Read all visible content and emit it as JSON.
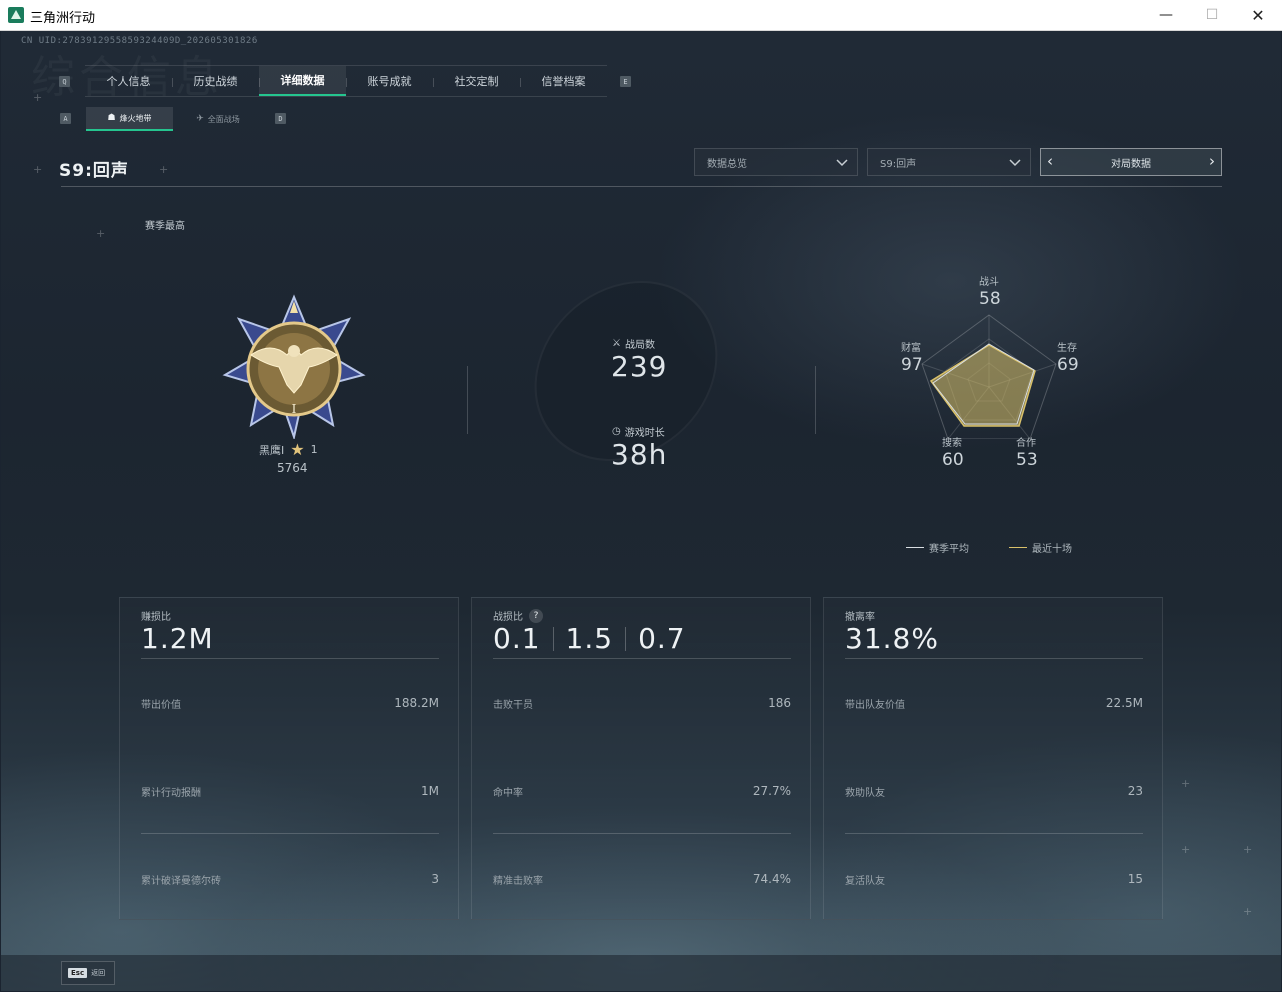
{
  "window": {
    "title": "三角洲行动",
    "minimize": "—",
    "maximize": "☐",
    "close": "✕"
  },
  "uid": "CN UID:2783912955859324409D_202605301826",
  "watermark": "综合信息",
  "keycaps": {
    "prev_tab": "Q",
    "next_tab": "E",
    "prev_sub": "A",
    "next_sub": "D"
  },
  "tabs": [
    {
      "label": "个人信息"
    },
    {
      "label": "历史战绩"
    },
    {
      "label": "详细数据",
      "active": true
    },
    {
      "label": "账号成就"
    },
    {
      "label": "社交定制"
    },
    {
      "label": "信誉档案"
    }
  ],
  "subtabs": [
    {
      "label": "烽火地带",
      "icon": "☗",
      "active": true
    },
    {
      "label": "全面战场",
      "icon": "✈",
      "active": false
    }
  ],
  "season": {
    "title": "S9:回声"
  },
  "dropdowns": {
    "overview": "数据总览",
    "season": "S9:回声"
  },
  "pager": {
    "label": "对局数据",
    "prev": "‹",
    "next": "›"
  },
  "season_best": "赛季最高",
  "rank": {
    "name": "黑鹰I",
    "stars": "1",
    "points": "5764",
    "star_icon": "★"
  },
  "matches": {
    "label": "战局数",
    "value": "239",
    "icon": "⚔"
  },
  "playtime": {
    "label": "游戏时长",
    "value": "38h",
    "icon": "◷"
  },
  "radar": {
    "combat": {
      "label": "战斗",
      "value": "58"
    },
    "survival": {
      "label": "生存",
      "value": "69"
    },
    "cooperation": {
      "label": "合作",
      "value": "53"
    },
    "search": {
      "label": "搜索",
      "value": "60"
    },
    "wealth": {
      "label": "财富",
      "value": "97"
    }
  },
  "legend": {
    "season_avg": {
      "label": "赛季平均",
      "color": "#d9dee2"
    },
    "recent_ten": {
      "label": "最近十场",
      "color": "#d9c16a"
    }
  },
  "panels": {
    "profit": {
      "label": "赚损比",
      "value": "1.2M",
      "rows": [
        {
          "k": "带出价值",
          "v": "188.2M"
        },
        {
          "k": "累计行动报酬",
          "v": "1M"
        },
        {
          "k": "累计破译曼德尔砖",
          "v": "3"
        }
      ]
    },
    "kd": {
      "label": "战损比",
      "help": "?",
      "values": [
        "0.1",
        "1.5",
        "0.7"
      ],
      "rows": [
        {
          "k": "击败干员",
          "v": "186"
        },
        {
          "k": "命中率",
          "v": "27.7%"
        },
        {
          "k": "精准击败率",
          "v": "74.4%"
        }
      ]
    },
    "extract": {
      "label": "撤离率",
      "value": "31.8%",
      "rows": [
        {
          "k": "带出队友价值",
          "v": "22.5M"
        },
        {
          "k": "救助队友",
          "v": "23"
        },
        {
          "k": "复活队友",
          "v": "15"
        }
      ]
    }
  },
  "footer": {
    "key": "Esc",
    "label": "返回"
  }
}
